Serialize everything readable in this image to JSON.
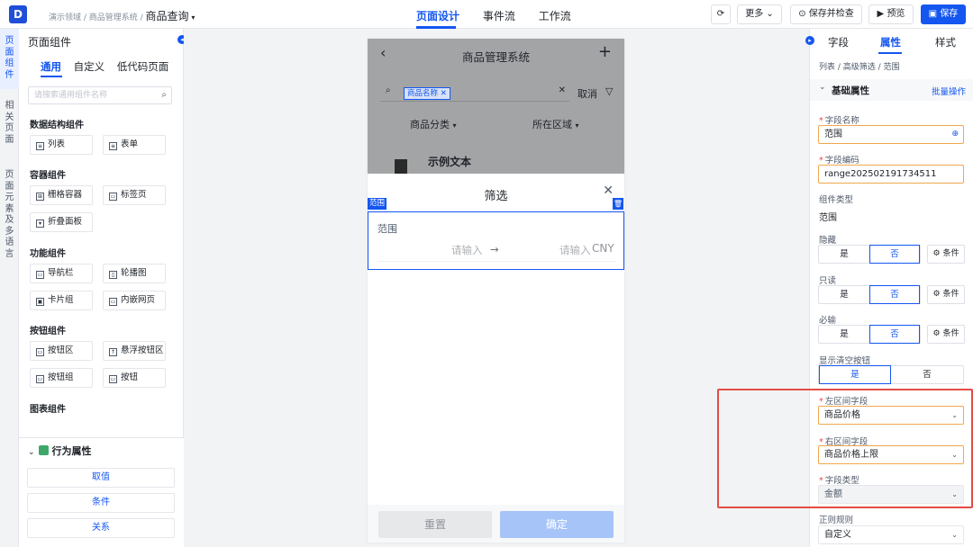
{
  "header": {
    "logo": "D",
    "breadcrumb_prefix": "演示领域 / 商品管理系统 /",
    "breadcrumb_current": "商品查询",
    "nav_tabs": [
      "页面设计",
      "事件流",
      "工作流"
    ],
    "refresh_icon": "refresh-icon",
    "more_label": "更多",
    "save_check_label": "保存并检查",
    "preview_label": "预览",
    "save_label": "保存"
  },
  "rail": [
    "页面组件",
    "相关页面",
    "页面元素及多语言"
  ],
  "left_panel": {
    "title": "页面组件",
    "tabs": [
      "通用",
      "自定义",
      "低代码页面"
    ],
    "search_placeholder": "请搜索通用组件名称",
    "sections": [
      {
        "title": "数据结构组件",
        "items": [
          "列表",
          "表单"
        ]
      },
      {
        "title": "容器组件",
        "items": [
          "栅格容器",
          "标签页",
          "折叠面板"
        ]
      },
      {
        "title": "功能组件",
        "items": [
          "导航栏",
          "轮播图",
          "卡片组",
          "内嵌网页"
        ]
      },
      {
        "title": "按钮组件",
        "items": [
          "按钮区",
          "悬浮按钮区",
          "按钮组",
          "按钮"
        ]
      },
      {
        "title": "图表组件",
        "items": []
      }
    ],
    "behavior_title": "行为属性",
    "behavior_items": [
      "取值",
      "条件",
      "关系"
    ]
  },
  "phone": {
    "title": "商品管理系统",
    "search_tag": "商品名称",
    "cancel": "取消",
    "dropdowns": [
      "商品分类",
      "所在区域"
    ],
    "item_text": "示例文本",
    "sheet_title": "筛选",
    "field_tag": "范围",
    "field_label": "范围",
    "left_placeholder": "请输入",
    "arrow": "→",
    "right_placeholder": "请输入",
    "currency": "CNY",
    "reset": "重置",
    "confirm": "确定"
  },
  "right_panel": {
    "tabs": [
      "字段",
      "属性",
      "样式"
    ],
    "breadcrumb": "列表 / 高级筛选 / 范围",
    "section_title": "基础属性",
    "batch_action": "批量操作",
    "field_name_label": "字段名称",
    "field_name_value": "范围",
    "field_code_label": "字段编码",
    "field_code_value": "range202502191734511",
    "component_type_label": "组件类型",
    "component_type_value": "范围",
    "hidden_label": "隐藏",
    "readonly_label": "只读",
    "required_label": "必输",
    "yes": "是",
    "no": "否",
    "condition": "条件",
    "clear_button_label": "显示清空按钮",
    "left_field_label": "左区间字段",
    "left_field_value": "商品价格",
    "right_field_label": "右区间字段",
    "right_field_value": "商品价格上限",
    "field_type_label": "字段类型",
    "field_type_value": "金额",
    "regex_label": "正则规则",
    "regex_value": "自定义"
  },
  "colors": {
    "accent": "#1456f0",
    "highlight": "#e34d47",
    "required": "#f53f3f"
  }
}
